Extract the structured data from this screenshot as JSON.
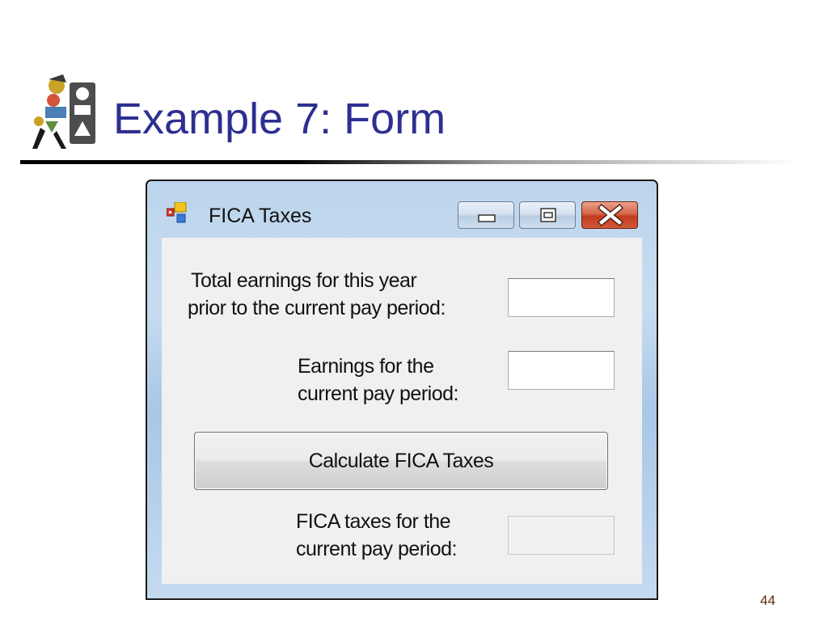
{
  "slide": {
    "title": "Example 7: Form",
    "number": "44",
    "logo_icon": "people-shapes-logo-icon"
  },
  "window": {
    "title": "FICA Taxes",
    "app_icon": "form-app-icon",
    "controls": {
      "minimize_icon": "minimize-icon",
      "maximize_icon": "maximize-icon",
      "close_icon": "close-icon"
    }
  },
  "form": {
    "prior_earnings": {
      "label_line1": "Total earnings for this year",
      "label_line2": "prior to the current pay period:",
      "value": ""
    },
    "current_earnings": {
      "label_line1": "Earnings for the",
      "label_line2": "current pay period:",
      "value": ""
    },
    "calculate_button": "Calculate FICA Taxes",
    "fica_result": {
      "label_line1": "FICA taxes for the",
      "label_line2": "current pay period:",
      "value": ""
    }
  },
  "colors": {
    "title": "#2e2f91",
    "window_frame": "#bcd5ec",
    "close_button": "#c23c1e",
    "client_background": "#f0f0f0"
  }
}
